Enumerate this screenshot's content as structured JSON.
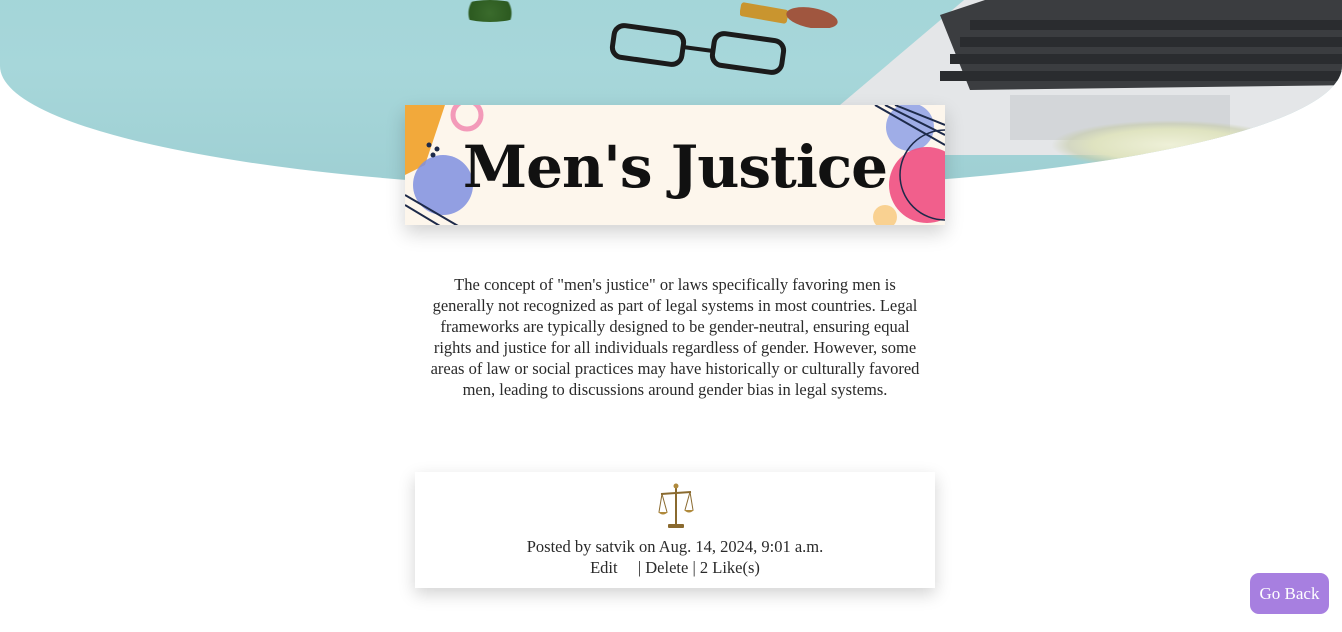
{
  "post": {
    "title": "Men's Justice",
    "body": "The concept of \"men's justice\" or laws specifically favoring men is generally not recognized as part of legal systems in most countries. Legal frameworks are typically designed to be gender-neutral, ensuring equal rights and justice for all individuals regardless of gender. However, some areas of law or social practices may have historically or culturally favored men, leading to discussions around gender bias in legal systems.",
    "icon": "scales-of-justice-icon",
    "posted_line": "Posted by satvik on Aug. 14, 2024, 9:01 a.m.",
    "edit_label": "Edit",
    "delete_label": "Delete",
    "likes_label": "2 Like(s)",
    "separator": "|"
  },
  "nav": {
    "go_back_label": "Go Back"
  },
  "colors": {
    "hero_bg": "#a7d7da",
    "banner_bg": "#fdf6ec",
    "go_back_bg": "#a77fe0",
    "text": "#2a2a2a"
  }
}
